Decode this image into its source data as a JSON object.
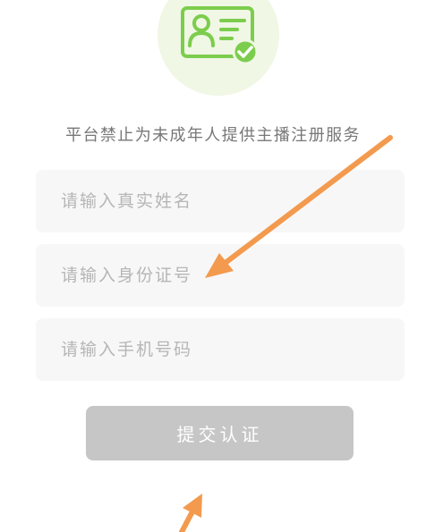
{
  "header": {
    "icon": "id-card-verified-icon"
  },
  "notice": {
    "text": "平台禁止为未成年人提供主播注册服务"
  },
  "form": {
    "name_placeholder": "请输入真实姓名",
    "id_placeholder": "请输入身份证号",
    "phone_placeholder": "请输入手机号码",
    "submit_label": "提交认证"
  },
  "annotations": {
    "arrow_color": "#f39a4e"
  },
  "colors": {
    "accent_green": "#7ccd4d",
    "hero_bg": "#f0f7e5",
    "field_bg": "#f7f7f7",
    "button_disabled": "#c6c6c6"
  }
}
